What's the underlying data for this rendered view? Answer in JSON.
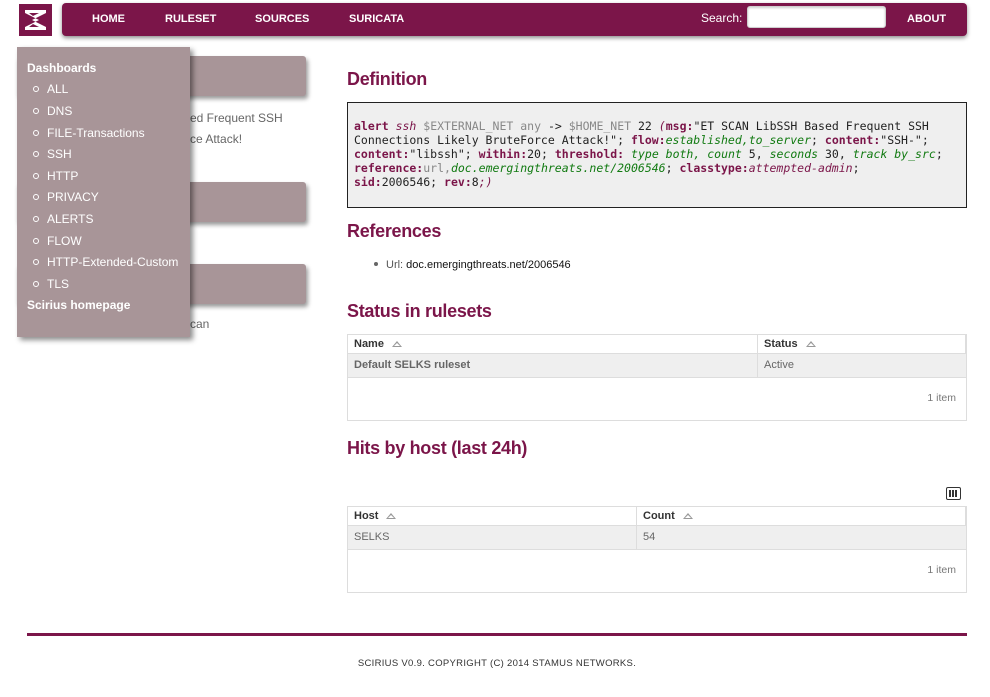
{
  "brand": {
    "logo_icon": "scirius-logo-icon",
    "color": "#7b1549"
  },
  "nav": {
    "items": [
      {
        "label": "HOME"
      },
      {
        "label": "RULESET"
      },
      {
        "label": "SOURCES"
      },
      {
        "label": "SURICATA"
      }
    ],
    "search_label": "Search:",
    "search_value": "",
    "about": "ABOUT"
  },
  "sidebar": {
    "partial_texts": [
      "ed Frequent SSH",
      "ce Attack!",
      "can"
    ]
  },
  "dropdown": {
    "header": "Dashboards",
    "items": [
      {
        "label": "ALL"
      },
      {
        "label": "DNS"
      },
      {
        "label": "FILE-Transactions"
      },
      {
        "label": "SSH"
      },
      {
        "label": "HTTP"
      },
      {
        "label": "PRIVACY"
      },
      {
        "label": "ALERTS"
      },
      {
        "label": "FLOW"
      },
      {
        "label": "HTTP-Extended-Custom"
      },
      {
        "label": "TLS"
      }
    ],
    "footer": "Scirius homepage"
  },
  "definition": {
    "title": "Definition",
    "rule": {
      "action": "alert",
      "proto": "ssh",
      "src": "$EXTERNAL_NET",
      "sport": "any",
      "arrow": "->",
      "dst": "$HOME_NET",
      "dport": "22",
      "open": "(",
      "msg_key": "msg:",
      "msg_val": "\"ET SCAN LibSSH Based Frequent SSH",
      "msg_val2": "Connections Likely BruteForce Attack!\"",
      "sc1": ";",
      "flow_key": "flow:",
      "flow_val": "established,to_server",
      "sc2": ";",
      "content_key": "content:",
      "content_val": "\"SSH-\"",
      "sc3": ";",
      "content2_key": "content:",
      "content2_val": "\"libssh\"",
      "sc4": ";",
      "within_key": "within:",
      "within_val": "20",
      "sc5": ";",
      "threshold_key": "threshold:",
      "t1": "type both,",
      "t2": "count",
      "t3": "5,",
      "t4": "seconds",
      "t5": "30,",
      "t6": "track by_src",
      "sc6": ";",
      "ref_key": "reference:",
      "ref_type": "url,",
      "ref_val": "doc.emergingthreats.net/2006546",
      "sc7": ";",
      "class_key": "classtype:",
      "class_val": "attempted-admin",
      "sc8": ";",
      "sid_key": "sid:",
      "sid_val": "2006546",
      "sc9": ";",
      "rev_key": "rev:",
      "rev_val": "8",
      "close": ";)"
    }
  },
  "references": {
    "title": "References",
    "items": [
      {
        "prefix": "Url:",
        "link": "doc.emergingthreats.net/2006546"
      }
    ]
  },
  "status": {
    "title": "Status in rulesets",
    "columns": [
      "Name",
      "Status"
    ],
    "rows": [
      {
        "name": "Default SELKS ruleset",
        "status": "Active"
      }
    ],
    "count": "1 item"
  },
  "hits": {
    "title": "Hits by host (last 24h)",
    "columns": [
      "Host",
      "Count"
    ],
    "rows": [
      {
        "host": "SELKS",
        "count": "54"
      }
    ],
    "count": "1 item",
    "export_icon": "export-csv-icon"
  },
  "footer": {
    "text": "SCIRIUS V0.9. COPYRIGHT (C) 2014 STAMUS NETWORKS."
  }
}
